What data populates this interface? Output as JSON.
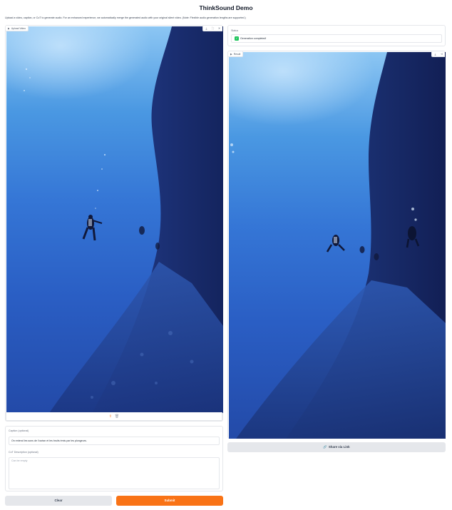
{
  "app": {
    "title": "ThinkSound Demo",
    "description": "Upload a video, caption, or CoT to generate audio. For an enhanced experience, we automatically merge the generated audio with your original silent video. (Note: Flexible audio generation lengths are supported.)"
  },
  "upload_video": {
    "label": "Upload Video",
    "label_icon": "video-icon",
    "corner_buttons": [
      "download-icon",
      "fullscreen-icon",
      "close-icon"
    ],
    "tool_icons": [
      "upload-icon",
      "trash-icon"
    ]
  },
  "caption": {
    "label": "Caption (optional)",
    "value": "On entend les sons de l'océan et les bruits émis par les plongeurs."
  },
  "cot": {
    "label": "CoT Description (optional)",
    "placeholder": "Can be empty"
  },
  "buttons": {
    "clear": "Clear",
    "submit": "Submit",
    "share": "Share via Link"
  },
  "status": {
    "label": "Status",
    "value": "Generation completed!"
  },
  "result": {
    "label": "Result",
    "label_icon": "video-icon",
    "corner_buttons": [
      "download-icon",
      "share-icon"
    ]
  },
  "colors": {
    "accent": "#f97316",
    "success": "#22c55e",
    "neutral_button": "#e5e7eb"
  }
}
